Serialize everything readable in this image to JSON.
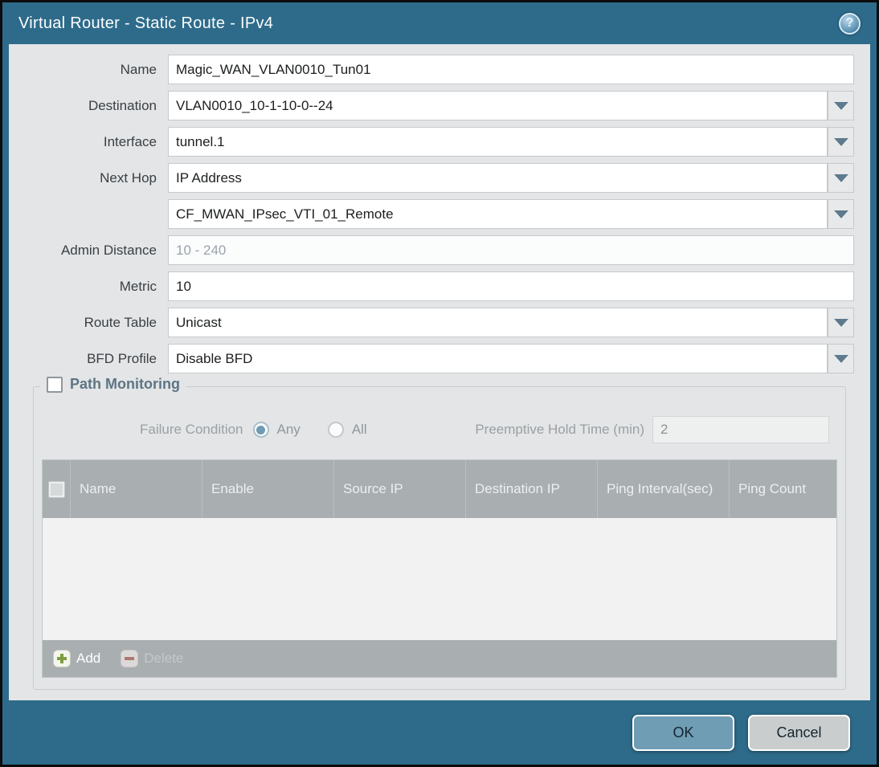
{
  "dialog": {
    "title": "Virtual Router - Static Route - IPv4"
  },
  "form": {
    "name": {
      "label": "Name",
      "value": "Magic_WAN_VLAN0010_Tun01"
    },
    "destination": {
      "label": "Destination",
      "value": "VLAN0010_10-1-10-0--24"
    },
    "interface": {
      "label": "Interface",
      "value": "tunnel.1"
    },
    "next_hop": {
      "label": "Next Hop",
      "value": "IP Address",
      "address_value": "CF_MWAN_IPsec_VTI_01_Remote"
    },
    "admin_distance": {
      "label": "Admin Distance",
      "placeholder": "10 - 240",
      "value": ""
    },
    "metric": {
      "label": "Metric",
      "value": "10"
    },
    "route_table": {
      "label": "Route Table",
      "value": "Unicast"
    },
    "bfd_profile": {
      "label": "BFD Profile",
      "value": "Disable BFD"
    }
  },
  "path_monitoring": {
    "title": "Path Monitoring",
    "checked": false,
    "failure_condition": {
      "label": "Failure Condition",
      "options": [
        {
          "label": "Any",
          "selected": true
        },
        {
          "label": "All",
          "selected": false
        }
      ]
    },
    "preemptive_hold_time": {
      "label": "Preemptive Hold Time (min)",
      "value": "2"
    },
    "table": {
      "columns": [
        "Name",
        "Enable",
        "Source IP",
        "Destination IP",
        "Ping Interval(sec)",
        "Ping Count"
      ],
      "rows": []
    },
    "actions": {
      "add": "Add",
      "delete": "Delete"
    }
  },
  "footer": {
    "ok": "OK",
    "cancel": "Cancel"
  },
  "colors": {
    "titlebar": "#2e6b8a",
    "content_bg": "#e3e5e6",
    "table_header_bg": "#a9aeb1",
    "ok_button": "#6f9db4",
    "cancel_button": "#c9cdce",
    "accent_radio": "#6f9cb3",
    "add_plus_green": "#7d9e3f",
    "delete_minus_red": "#b06a60"
  }
}
